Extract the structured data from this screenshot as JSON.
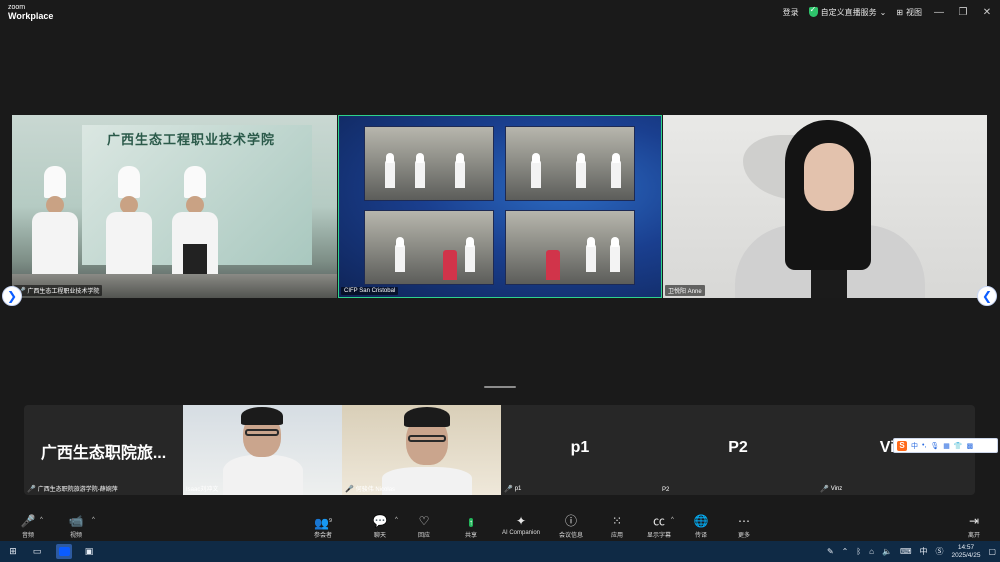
{
  "app": {
    "logo_top": "zoom",
    "logo_bottom": "Workplace"
  },
  "titlebar": {
    "login": "登录",
    "live_service": "自定义直播服务",
    "view": "视图"
  },
  "tiles": [
    {
      "name": "广西生态工程职业技术学院",
      "school_text": "广西生态工程职业技术学院"
    },
    {
      "name": "CIFP San Cristobal"
    },
    {
      "name": "卫悦阳 Anne"
    }
  ],
  "strip": [
    {
      "big": "广西生态职院旅...",
      "label": "广西生态职院旅游学院-薛婉萍",
      "muted": true
    },
    {
      "label": "Isaac刘冲文",
      "muted": false
    },
    {
      "label": "何骏伟 Nicolas",
      "muted": true
    },
    {
      "big": "p1",
      "label": "p1",
      "muted": true
    },
    {
      "big": "P2",
      "label": "P2",
      "muted": false
    },
    {
      "big": "Vinz",
      "label": "Vinz",
      "muted": true
    }
  ],
  "ime": {
    "logo": "S",
    "lang": "中"
  },
  "toolbar": {
    "audio": "音频",
    "video": "视频",
    "participants": "参会者",
    "participants_count": "9",
    "chat": "聊天",
    "react": "回应",
    "share": "共享",
    "ai": "AI Companion",
    "info": "会议信息",
    "apps": "应用",
    "captions": "显示字幕",
    "translate": "传译",
    "more": "更多",
    "leave": "离开"
  },
  "taskbar": {
    "ime_lang": "中",
    "time": "14:57",
    "date": "2025/4/25"
  },
  "colors": {
    "accent": "#0b5cff",
    "active_tile_border": "#2ed38c",
    "share_green": "#22b55a",
    "leave_red": "#e04848"
  }
}
